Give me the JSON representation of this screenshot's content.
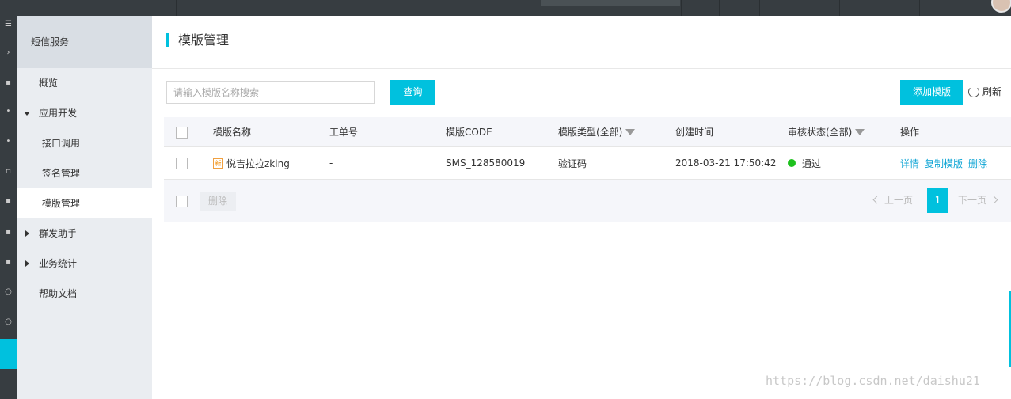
{
  "sidebar": {
    "service_title": "短信服务",
    "items": [
      {
        "label": "概览"
      },
      {
        "label": "应用开发"
      },
      {
        "label": "接口调用"
      },
      {
        "label": "签名管理"
      },
      {
        "label": "模版管理"
      },
      {
        "label": "群发助手"
      },
      {
        "label": "业务统计"
      },
      {
        "label": "帮助文档"
      }
    ]
  },
  "page": {
    "title": "模版管理"
  },
  "toolbar": {
    "search_placeholder": "请输入模版名称搜索",
    "query_label": "查询",
    "add_label": "添加模版",
    "refresh_label": "刷新"
  },
  "table": {
    "columns": [
      "模版名称",
      "工单号",
      "模版CODE",
      "模版类型(全部)",
      "创建时间",
      "审核状态(全部)",
      "操作"
    ],
    "rows": [
      {
        "badge": "新",
        "name": "悦吉拉拉zking",
        "order_no": "-",
        "code": "SMS_128580019",
        "type": "验证码",
        "created": "2018-03-21 17:50:42",
        "status": "通过",
        "actions": [
          "详情",
          "复制模版",
          "删除"
        ]
      }
    ],
    "batch_delete_label": "删除"
  },
  "pagination": {
    "prev_label": "上一页",
    "current_page": "1",
    "next_label": "下一页"
  },
  "watermark": "https://blog.csdn.net/daishu21",
  "colors": {
    "accent": "#00c1de",
    "topbar": "#373d41",
    "sidebar": "#eaedf1",
    "status_ok": "#1dc11d",
    "link": "#0aa3d4"
  }
}
